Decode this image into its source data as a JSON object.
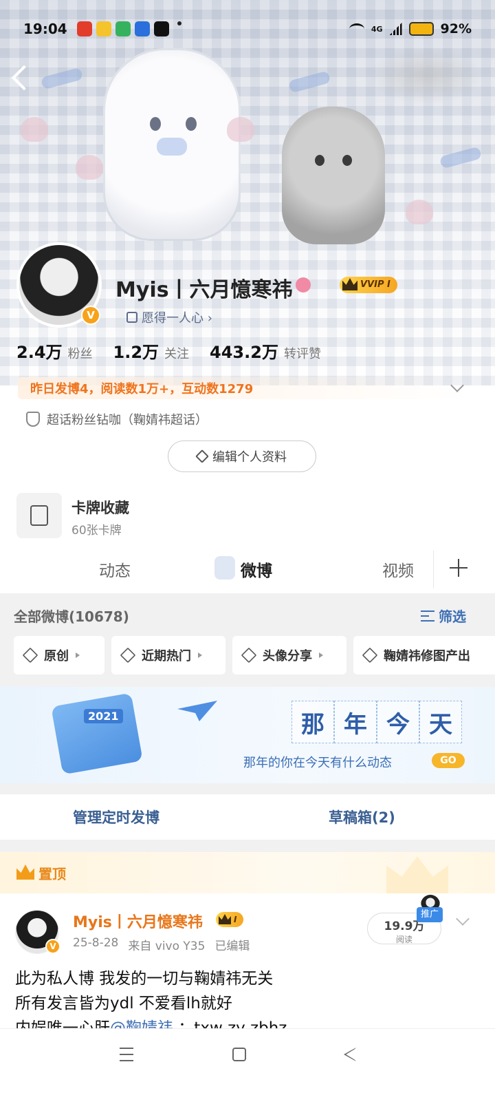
{
  "status_bar": {
    "time": "19:04",
    "network": "4G",
    "battery": "92%"
  },
  "profile": {
    "name": "Myis丨六月憶寒祎",
    "vip_label": "VVIP Ⅰ",
    "verified_mark": "V",
    "signature": "愿得一人心 ›",
    "stats": [
      {
        "num": "2.4万",
        "label": "粉丝"
      },
      {
        "num": "1.2万",
        "label": "关注"
      },
      {
        "num": "443.2万",
        "label": "转评赞"
      }
    ],
    "activity": "昨日发博4，阅读数1万+，互动数1279",
    "supertalk": "超话粉丝钻咖（鞠婧祎超话）",
    "edit_button": "编辑个人资料"
  },
  "card_collection": {
    "title": "卡牌收藏",
    "subtitle": "60张卡牌"
  },
  "tabs": [
    {
      "label": "动态",
      "active": false
    },
    {
      "label": "微博",
      "active": true
    },
    {
      "label": "视频",
      "active": false
    }
  ],
  "filter": {
    "all_weibo": "全部微博(10678)",
    "filter_label": "筛选",
    "chips": [
      "原创",
      "近期热门",
      "头像分享",
      "鞠婧祎修图产出"
    ]
  },
  "banner": {
    "year": "2021",
    "title_chars": [
      "那",
      "年",
      "今",
      "天"
    ],
    "subtitle": "那年的你在今天有什么动态",
    "go_label": "GO"
  },
  "manage": {
    "scheduled": "管理定时发博",
    "drafts": "草稿箱(2)"
  },
  "pinned": {
    "label": "置顶",
    "author": "Myis丨六月憶寒祎",
    "vip_label": "Ⅰ",
    "verified_mark": "V",
    "date": "25-8-28",
    "source": "来自 vivo Y35",
    "edited": "已编辑",
    "reads": "19.9万",
    "reads_label": "阅读",
    "promo_tag": "推广",
    "lines": [
      "此为私人博 我发的一切与鞠婧祎无关",
      "所有发言皆为ydl 不爱看lh就好"
    ],
    "line3_prefix": "内娱唯一心肝",
    "line3_mention": "@鞠婧祎",
    "line3_suffix": " ：txw zy zbhz"
  },
  "colors": {
    "accent_orange": "#f0731d",
    "link_blue": "#3d6fb5",
    "vip_gold": "#f5a623"
  }
}
